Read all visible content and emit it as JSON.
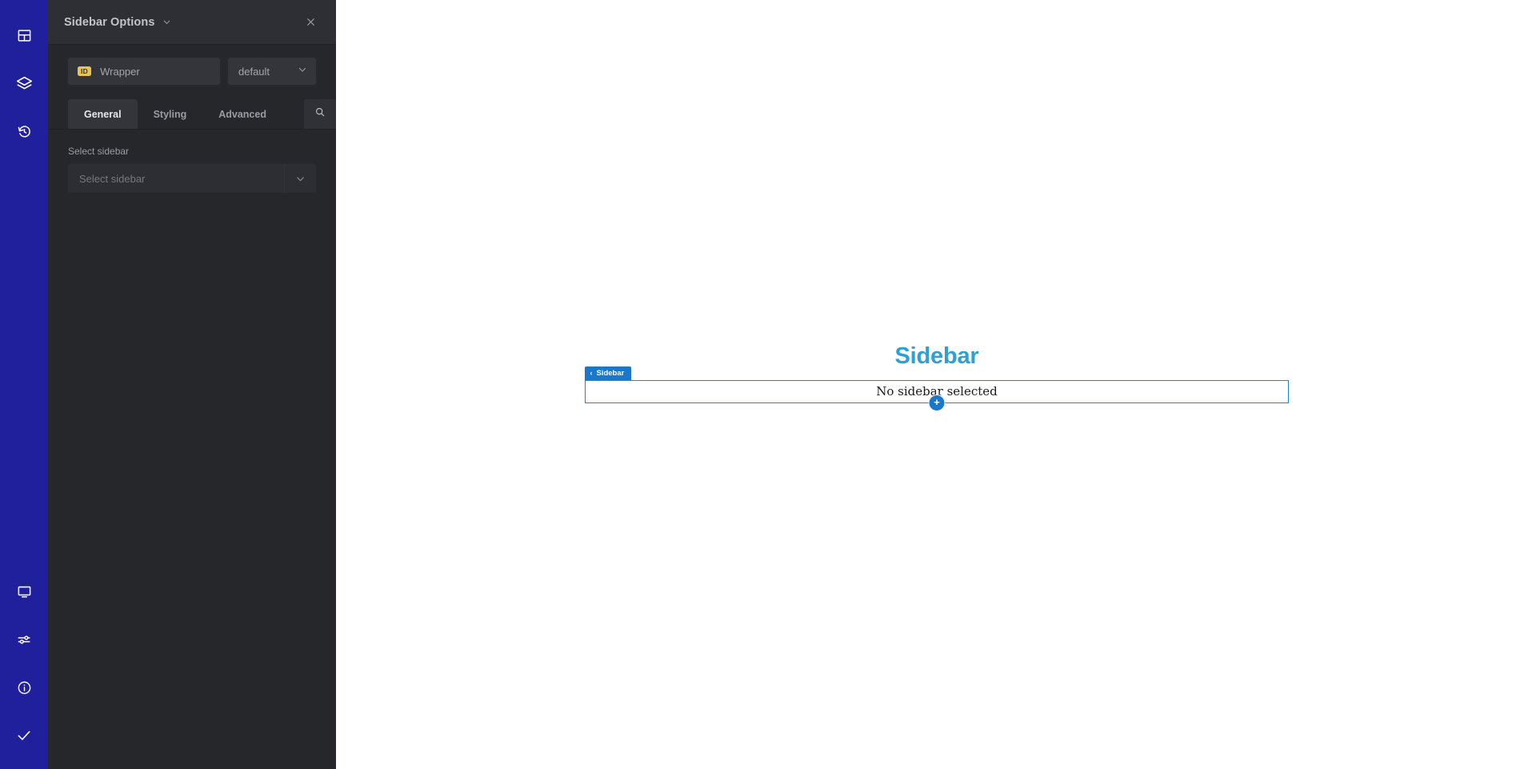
{
  "rail": {
    "top_items": [
      {
        "name": "layout-icon",
        "label": "Elements"
      },
      {
        "name": "layers-icon",
        "label": "Navigator"
      },
      {
        "name": "history-icon",
        "label": "History"
      }
    ],
    "bottom_items": [
      {
        "name": "monitor-icon",
        "label": "Responsive Mode"
      },
      {
        "name": "sliders-icon",
        "label": "Preferences"
      },
      {
        "name": "info-circle-icon",
        "label": "Help"
      },
      {
        "name": "check-icon",
        "label": "Publish"
      }
    ],
    "background_color": "#21209c"
  },
  "panel": {
    "header": {
      "title": "Sidebar Options",
      "caret_icon": "chevron-down-icon",
      "close_icon": "close-icon"
    },
    "element_row": {
      "badge": "ID",
      "badge_color": "#eec154",
      "element_name": "Wrapper",
      "state_value": "default",
      "state_caret_icon": "chevron-down-icon"
    },
    "tabs": [
      {
        "label": "General",
        "active": true
      },
      {
        "label": "Styling",
        "active": false
      },
      {
        "label": "Advanced",
        "active": false
      }
    ],
    "search_icon": "search-icon",
    "controls": [
      {
        "label": "Select sidebar",
        "placeholder": "Select sidebar",
        "value": "",
        "arrow_icon": "chevron-down-icon"
      }
    ],
    "background_color": "#26272b"
  },
  "canvas": {
    "widget": {
      "heading": "Sidebar",
      "heading_color": "#2f9fd6",
      "element_label": "Sidebar",
      "element_label_chevron": "‹",
      "element_label_color": "#1977cc",
      "body_text": "No sidebar selected",
      "border_color": "#1d84d4",
      "add_button_label": "+"
    },
    "background_color": "#ffffff"
  }
}
